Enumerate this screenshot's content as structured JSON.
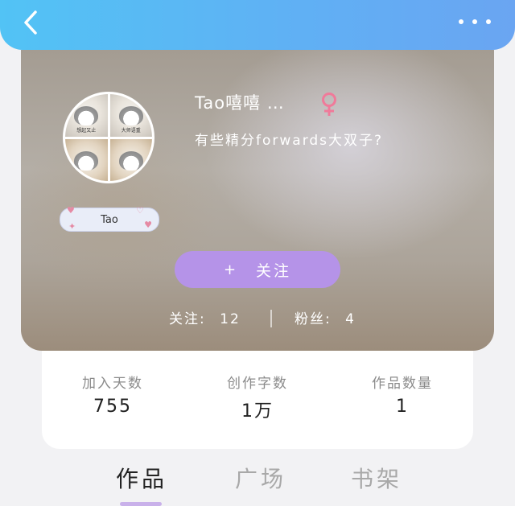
{
  "header": {
    "back_icon": "chevron-left-icon",
    "more_icon": "more-dots-icon"
  },
  "profile": {
    "username": "Tao嘻嘻 …",
    "gender_icon": "female-icon",
    "gender_color": "#f07a9a",
    "bio": "有些精分forwards大双子?",
    "tag": "Tao",
    "avatar_captions": [
      "想起又止",
      "大师语重"
    ],
    "follow_label": "关注",
    "follow_plus": "+",
    "following_label": "关注:",
    "following_count": "12",
    "fans_label": "粉丝:",
    "fans_count": "4"
  },
  "info": {
    "days_label": "加入天数",
    "days_value": "755",
    "words_label": "创作字数",
    "words_value": "1万",
    "works_label": "作品数量",
    "works_value": "1"
  },
  "tabs": [
    {
      "label": "作品",
      "active": true
    },
    {
      "label": "广场",
      "active": false
    },
    {
      "label": "书架",
      "active": false
    }
  ],
  "colors": {
    "header_gradient_start": "#52c3f5",
    "header_gradient_end": "#6aa5f2",
    "follow_button": "#b593e8",
    "tab_indicator": "#c9b1ea"
  }
}
